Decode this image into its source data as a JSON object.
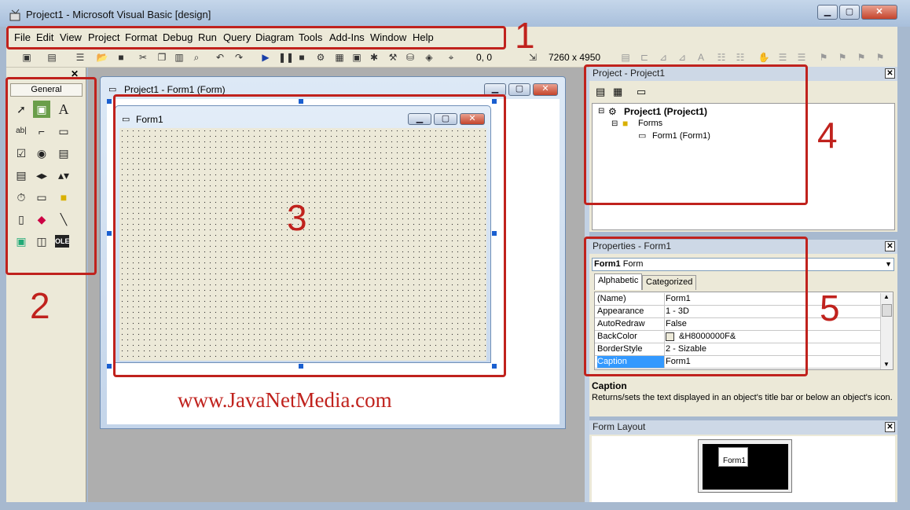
{
  "window": {
    "title": "Project1 - Microsoft Visual Basic [design]",
    "controls": {
      "minimize": "▁",
      "maximize": "▢",
      "close": "✕"
    }
  },
  "menu": [
    "File",
    "Edit",
    "View",
    "Project",
    "Format",
    "Debug",
    "Run",
    "Query",
    "Diagram",
    "Tools",
    "Add-Ins",
    "Window",
    "Help"
  ],
  "toolbar": {
    "position": "0, 0",
    "size": "7260 x 4950"
  },
  "toolbox": {
    "tab": "General"
  },
  "designer": {
    "title": "Project1 - Form1 (Form)",
    "form_title": "Form1",
    "watermark": "www.JavaNetMedia.com"
  },
  "project_explorer": {
    "title": "Project - Project1",
    "root": "Project1 (Project1)",
    "folder": "Forms",
    "item": "Form1 (Form1)"
  },
  "properties": {
    "title": "Properties - Form1",
    "object_name": "Form1",
    "object_type": "Form",
    "tabs": [
      "Alphabetic",
      "Categorized"
    ],
    "rows": [
      {
        "name": "(Name)",
        "value": "Form1"
      },
      {
        "name": "Appearance",
        "value": "1 - 3D"
      },
      {
        "name": "AutoRedraw",
        "value": "False"
      },
      {
        "name": "BackColor",
        "value": "&H8000000F&"
      },
      {
        "name": "BorderStyle",
        "value": "2 - Sizable"
      },
      {
        "name": "Caption",
        "value": "Form1"
      }
    ],
    "desc_title": "Caption",
    "desc_text": "Returns/sets the text displayed in an object's title bar or below an object's icon."
  },
  "form_layout": {
    "title": "Form Layout",
    "mini_form": "Form1"
  },
  "callouts": [
    "1",
    "2",
    "3",
    "4",
    "5"
  ],
  "colors": {
    "accent": "#c0221d",
    "selection": "#3399ff"
  }
}
